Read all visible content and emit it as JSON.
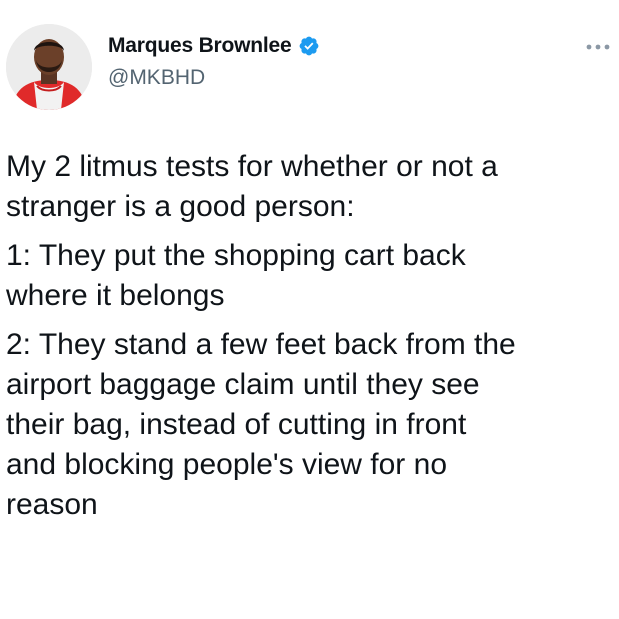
{
  "tweet": {
    "author": {
      "display_name": "Marques Brownlee",
      "handle": "@MKBHD",
      "verified": true,
      "avatar_icon": "profile-photo-red-hoodie"
    },
    "menu_icon": "more-horizontal-icon",
    "paragraphs": [
      "My 2 litmus tests for whether or not a\nstranger is a good person:",
      "1: They put the shopping cart back\nwhere it belongs",
      "2: They stand a few feet back from the\nairport baggage claim until they see\ntheir bag, instead of cutting in front\nand blocking people's view for no\nreason"
    ]
  },
  "colors": {
    "text_primary": "#0f1419",
    "text_secondary": "#536471",
    "verified_blue": "#1d9bf0",
    "menu_gray": "#8b98a5"
  }
}
